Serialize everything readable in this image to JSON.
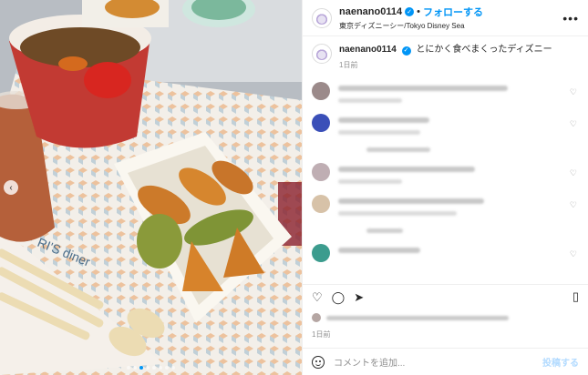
{
  "post": {
    "username": "naenano0114",
    "separator": "•",
    "follow_label": "フォローする",
    "location": "東京ディズニーシー/Tokyo Disney Sea",
    "more_label": "•••",
    "caption_username": "naenano0114",
    "caption_text": "とにかく食べまくったディズニー",
    "caption_time": "1日前",
    "date": "1日前"
  },
  "comments": [
    {
      "avatar_color": "#9b8a8a",
      "w1": 186,
      "w2": 70
    },
    {
      "avatar_color": "#3a4fb8",
      "w1": 100,
      "w2": 90,
      "reply_w": 70
    },
    {
      "avatar_color": "#bfaeb3",
      "w1": 150,
      "w2": 70
    },
    {
      "avatar_color": "#d7c2a8",
      "w1": 160,
      "w2": 130,
      "reply_w": 40
    },
    {
      "avatar_color": "#3c9c8e",
      "w1": 90,
      "w2": 0
    }
  ],
  "add_comment": {
    "placeholder": "コメントを追加...",
    "post_label": "投稿する"
  },
  "icons": [
    "heart-icon",
    "comment-icon",
    "share-icon",
    "bookmark-icon",
    "emoji-icon",
    "verified-icon",
    "more-icon",
    "carousel-prev-icon"
  ],
  "colors": {
    "accent": "#0095f6",
    "text": "#262626",
    "muted": "#8e8e8e"
  },
  "carousel": {
    "count": 8,
    "active": 2
  }
}
